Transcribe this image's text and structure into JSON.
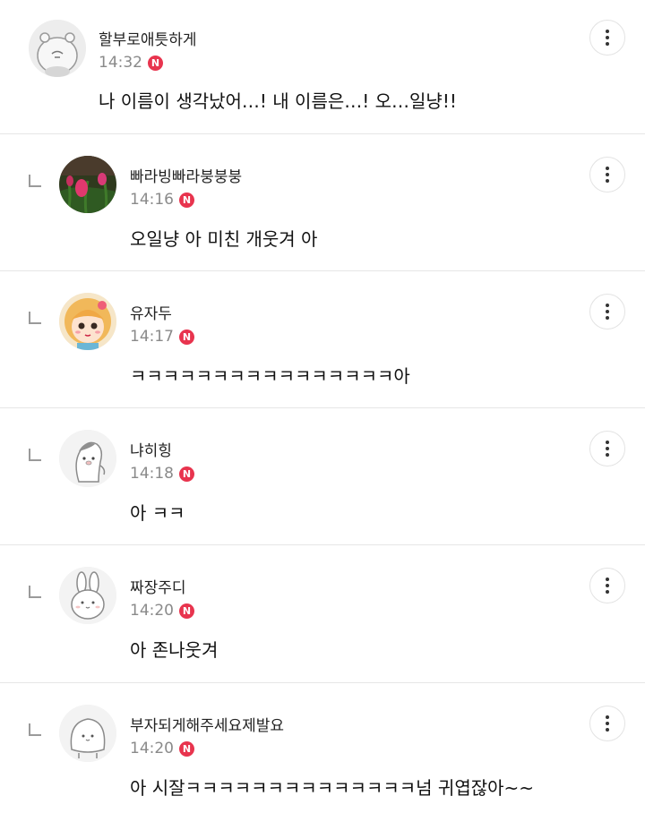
{
  "badge_label": "N",
  "comments": [
    {
      "nickname": "할부로애틋하게",
      "time": "14:32",
      "text": "나 이름이 생각났어…! 내 이름은…! 오…일냥!!",
      "avatar": "hamster-avatar-icon"
    },
    {
      "nickname": "빠라빙빠라붕붕붕",
      "time": "14:16",
      "text": "오일냥 아 미친 개웃겨 아",
      "avatar": "tulip-photo-avatar"
    },
    {
      "nickname": "유자두",
      "time": "14:17",
      "text": "ㅋㅋㅋㅋㅋㅋㅋㅋㅋㅋㅋㅋㅋㅋㅋㅋ아",
      "avatar": "girl-character-avatar"
    },
    {
      "nickname": "냐히힝",
      "time": "14:18",
      "text": "아 ㅋㅋ",
      "avatar": "penguin-avatar-icon"
    },
    {
      "nickname": "짜장주디",
      "time": "14:20",
      "text": "아 존나웃겨",
      "avatar": "rabbit-avatar-icon"
    },
    {
      "nickname": "부자되게해주세요제발요",
      "time": "14:20",
      "text": "아 시잘ㅋㅋㅋㅋㅋㅋㅋㅋㅋㅋㅋㅋㅋㅋ넘 귀엽잖아~~",
      "avatar": "blob-avatar-icon"
    }
  ],
  "colors": {
    "badge": "#e8344e",
    "divider": "#e6e6e6",
    "meta_text": "#8a8a8a"
  }
}
